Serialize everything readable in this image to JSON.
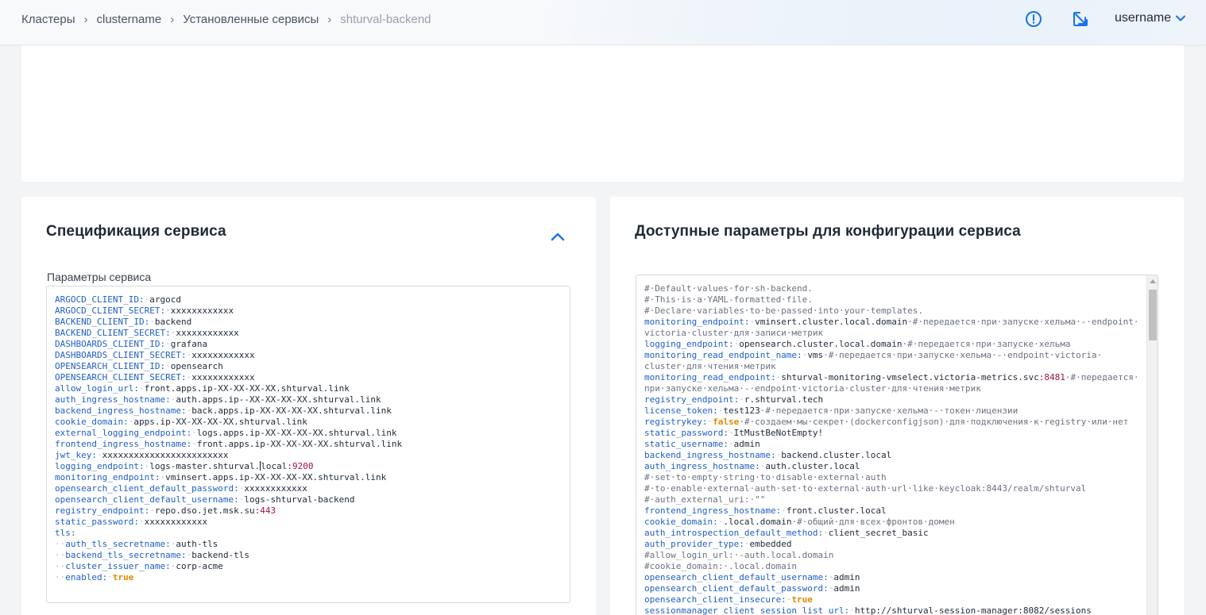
{
  "breadcrumb": {
    "items": [
      "Кластеры",
      "clustername",
      "Установленные сервисы"
    ],
    "current": "shturval-backend",
    "separator": "›"
  },
  "header": {
    "username": "username",
    "icons": [
      "alert-circle-icon",
      "external-link-icon",
      "chevron-down-icon"
    ],
    "accent": "#1a73e8"
  },
  "spec_card": {
    "title": "Спецификация сервиса",
    "field_label": "Параметры сервиса",
    "lines": [
      [
        [
          "k",
          "ARGOCD_CLIENT_ID:"
        ],
        [
          "d",
          "·"
        ],
        [
          "v",
          "argocd"
        ]
      ],
      [
        [
          "k",
          "ARGOCD_CLIENT_SECRET:"
        ],
        [
          "d",
          "·"
        ],
        [
          "v",
          "xxxxxxxxxxxx"
        ]
      ],
      [
        [
          "k",
          "BACKEND_CLIENT_ID:"
        ],
        [
          "d",
          "·"
        ],
        [
          "v",
          "backend"
        ]
      ],
      [
        [
          "k",
          "BACKEND_CLIENT_SECRET:"
        ],
        [
          "d",
          "·"
        ],
        [
          "v",
          "xxxxxxxxxxxx"
        ]
      ],
      [
        [
          "k",
          "DASHBOARDS_CLIENT_ID:"
        ],
        [
          "d",
          "·"
        ],
        [
          "v",
          "grafana"
        ]
      ],
      [
        [
          "k",
          "DASHBOARDS_CLIENT_SECRET:"
        ],
        [
          "d",
          "·"
        ],
        [
          "v",
          "xxxxxxxxxxxx"
        ]
      ],
      [
        [
          "k",
          "OPENSEARCH_CLIENT_ID:"
        ],
        [
          "d",
          "·"
        ],
        [
          "v",
          "opensearch"
        ]
      ],
      [
        [
          "k",
          "OPENSEARCH_CLIENT_SECRET:"
        ],
        [
          "d",
          "·"
        ],
        [
          "v",
          "xxxxxxxxxxxx"
        ]
      ],
      [
        [
          "k",
          "allow_login_url:"
        ],
        [
          "d",
          "·"
        ],
        [
          "v",
          "front.apps.ip-XX-XX-XX-XX.shturval.link"
        ]
      ],
      [
        [
          "k",
          "auth_ingress_hostname:"
        ],
        [
          "d",
          "·"
        ],
        [
          "v",
          "auth.apps.ip--XX-XX-XX-XX.shturval.link"
        ]
      ],
      [
        [
          "k",
          "backend_ingress_hostname:"
        ],
        [
          "d",
          "·"
        ],
        [
          "v",
          "back.apps.ip-XX-XX-XX-XX.shturval.link"
        ]
      ],
      [
        [
          "k",
          "cookie_domain:"
        ],
        [
          "d",
          "·"
        ],
        [
          "v",
          "apps.ip-XX-XX-XX-XX.shturval.link"
        ]
      ],
      [
        [
          "k",
          "external_logging_endpoint:"
        ],
        [
          "d",
          "·"
        ],
        [
          "v",
          "logs.apps.ip-XX-XX-XX-XX.shturval.link"
        ]
      ],
      [
        [
          "k",
          "frontend_ingress_hostname:"
        ],
        [
          "d",
          "·"
        ],
        [
          "v",
          "front.apps.ip-XX-XX-XX-XX.shturval.link"
        ]
      ],
      [
        [
          "k",
          "jwt_key:"
        ],
        [
          "d",
          "·"
        ],
        [
          "v",
          "xxxxxxxxxxxxxxxxxxxxxxxx"
        ]
      ],
      [
        [
          "k",
          "logging_endpoint:"
        ],
        [
          "d",
          "·"
        ],
        [
          "v",
          "logs-master.shturval."
        ],
        [
          "cur",
          ""
        ],
        [
          "v",
          "local"
        ],
        [
          "n",
          ":9200"
        ]
      ],
      [
        [
          "k",
          "monitoring_endpoint:"
        ],
        [
          "d",
          "·"
        ],
        [
          "v",
          "vminsert.apps.ip-XX-XX-XX-XX.shturval.link"
        ]
      ],
      [
        [
          "k",
          "opensearch_client_default_password:"
        ],
        [
          "d",
          "·"
        ],
        [
          "v",
          "xxxxxxxxxxxx"
        ]
      ],
      [
        [
          "k",
          "opensearch_client_default_username:"
        ],
        [
          "d",
          "·"
        ],
        [
          "v",
          "logs-shturval-backend"
        ]
      ],
      [
        [
          "k",
          "registry_endpoint:"
        ],
        [
          "d",
          "·"
        ],
        [
          "v",
          "repo.dso.jet.msk.su"
        ],
        [
          "n",
          ":443"
        ]
      ],
      [
        [
          "k",
          "static_password:"
        ],
        [
          "d",
          "·"
        ],
        [
          "v",
          "xxxxxxxxxxxx"
        ]
      ],
      [
        [
          "k",
          "tls:"
        ]
      ],
      [
        [
          "d",
          "··"
        ],
        [
          "k",
          "auth_tls_secretname:"
        ],
        [
          "d",
          "·"
        ],
        [
          "v",
          "auth-tls"
        ]
      ],
      [
        [
          "d",
          "··"
        ],
        [
          "k",
          "backend_tls_secretname:"
        ],
        [
          "d",
          "·"
        ],
        [
          "v",
          "backend-tls"
        ]
      ],
      [
        [
          "d",
          "··"
        ],
        [
          "k",
          "cluster_issuer_name:"
        ],
        [
          "d",
          "·"
        ],
        [
          "v",
          "corp-acme"
        ]
      ],
      [
        [
          "d",
          "··"
        ],
        [
          "k",
          "enabled:"
        ],
        [
          "d",
          "·"
        ],
        [
          "b",
          "true"
        ]
      ]
    ]
  },
  "config_card": {
    "title": "Доступные параметры для конфигурации сервиса",
    "lines": [
      [
        [
          "c",
          "#·Default·values·for·sh-backend."
        ]
      ],
      [
        [
          "c",
          "#·This·is·a·YAML-formatted·file."
        ]
      ],
      [
        [
          "c",
          "#·Declare·variables·to·be·passed·into·your·templates."
        ]
      ],
      [
        [
          "k",
          "monitoring_endpoint:"
        ],
        [
          "d",
          "·"
        ],
        [
          "v",
          "vminsert.cluster.local.domain"
        ],
        [
          "c",
          "·#·передается·при·запуске·хельма·-·endpoint·"
        ]
      ],
      [
        [
          "c",
          "victoria·cluster·для·записи·метрик"
        ]
      ],
      [
        [
          "k",
          "logging_endpoint:"
        ],
        [
          "d",
          "·"
        ],
        [
          "v",
          "opensearch.cluster.local.domain"
        ],
        [
          "c",
          "·#·передается·при·запуске·хельма"
        ]
      ],
      [
        [
          "k",
          "monitoring_read_endpoint_name:"
        ],
        [
          "d",
          "·"
        ],
        [
          "v",
          "vms"
        ],
        [
          "c",
          "·#·передается·при·запуске·хельма·-·endpoint·victoria·"
        ]
      ],
      [
        [
          "c",
          "cluster·для·чтения·метрик"
        ]
      ],
      [
        [
          "k",
          "monitoring_read_endpoint:"
        ],
        [
          "d",
          "·"
        ],
        [
          "v",
          "shturval-monitoring-vmselect.victoria-metrics.svc"
        ],
        [
          "n",
          ":8481"
        ],
        [
          "c",
          "·#·передается·"
        ]
      ],
      [
        [
          "c",
          "при·запуске·хельма·-·endpoint·victoria·cluster·для·чтения·метрик"
        ]
      ],
      [
        [
          "k",
          "registry_endpoint:"
        ],
        [
          "d",
          "·"
        ],
        [
          "v",
          "r.shturval.tech"
        ]
      ],
      [
        [
          "k",
          "license_token:"
        ],
        [
          "d",
          "·"
        ],
        [
          "v",
          "test123"
        ],
        [
          "c",
          "·#·передается·при·запуске·хельма·-·токен·лицензии"
        ]
      ],
      [
        [
          "k",
          "registrykey:"
        ],
        [
          "d",
          "·"
        ],
        [
          "b",
          "false"
        ],
        [
          "c",
          "·#·создаем·мы·секрет·(dockerconfigjson)·для·подключения·к·registry·или·нет"
        ]
      ],
      [
        [
          "k",
          "static_password:"
        ],
        [
          "d",
          "·"
        ],
        [
          "v",
          "ItMustBeNotEmpty!"
        ]
      ],
      [
        [
          "k",
          "static_username:"
        ],
        [
          "d",
          "·"
        ],
        [
          "v",
          "admin"
        ]
      ],
      [
        [
          "k",
          "backend_ingress_hostname:"
        ],
        [
          "d",
          "·"
        ],
        [
          "v",
          "backend.cluster.local"
        ]
      ],
      [
        [
          "k",
          "auth_ingress_hostname:"
        ],
        [
          "d",
          "·"
        ],
        [
          "v",
          "auth.cluster.local"
        ]
      ],
      [
        [
          "c",
          "#·set·to·empty·string·to·disable·external·auth"
        ]
      ],
      [
        [
          "c",
          "#·to·enable·external·auth·set·to·external·auth·url·like·keycloak:8443/realm/shturval"
        ]
      ],
      [
        [
          "c",
          "#·auth_external_uri:·\"\""
        ]
      ],
      [
        [
          "k",
          "frontend_ingress_hostname:"
        ],
        [
          "d",
          "·"
        ],
        [
          "v",
          "front.cluster.local"
        ]
      ],
      [
        [
          "k",
          "cookie_domain:"
        ],
        [
          "d",
          "·"
        ],
        [
          "v",
          ".local.domain"
        ],
        [
          "c",
          "·#·общий·для·всех·фронтов·домен"
        ]
      ],
      [
        [
          "k",
          "auth_introspection_default_method:"
        ],
        [
          "d",
          "·"
        ],
        [
          "v",
          "client_secret_basic"
        ]
      ],
      [
        [
          "k",
          "auth_provider_type:"
        ],
        [
          "d",
          "·"
        ],
        [
          "v",
          "embedded"
        ]
      ],
      [
        [
          "c",
          "#allow_login_url:·-auth.local.domain"
        ]
      ],
      [
        [
          "c",
          "#cookie_domain:·.local.domain"
        ]
      ],
      [
        [
          "k",
          "opensearch_client_default_username:"
        ],
        [
          "d",
          "·"
        ],
        [
          "v",
          "admin"
        ]
      ],
      [
        [
          "k",
          "opensearch_client_default_password:"
        ],
        [
          "d",
          "·"
        ],
        [
          "v",
          "admin"
        ]
      ],
      [
        [
          "k",
          "opensearch_client_insecure:"
        ],
        [
          "d",
          "·"
        ],
        [
          "b",
          "true"
        ]
      ],
      [
        [
          "k",
          "sessionmanager_client_session_list_url:"
        ],
        [
          "d",
          "·"
        ],
        [
          "v",
          "http://shturval-session-manager:8082/sessions"
        ]
      ]
    ]
  }
}
